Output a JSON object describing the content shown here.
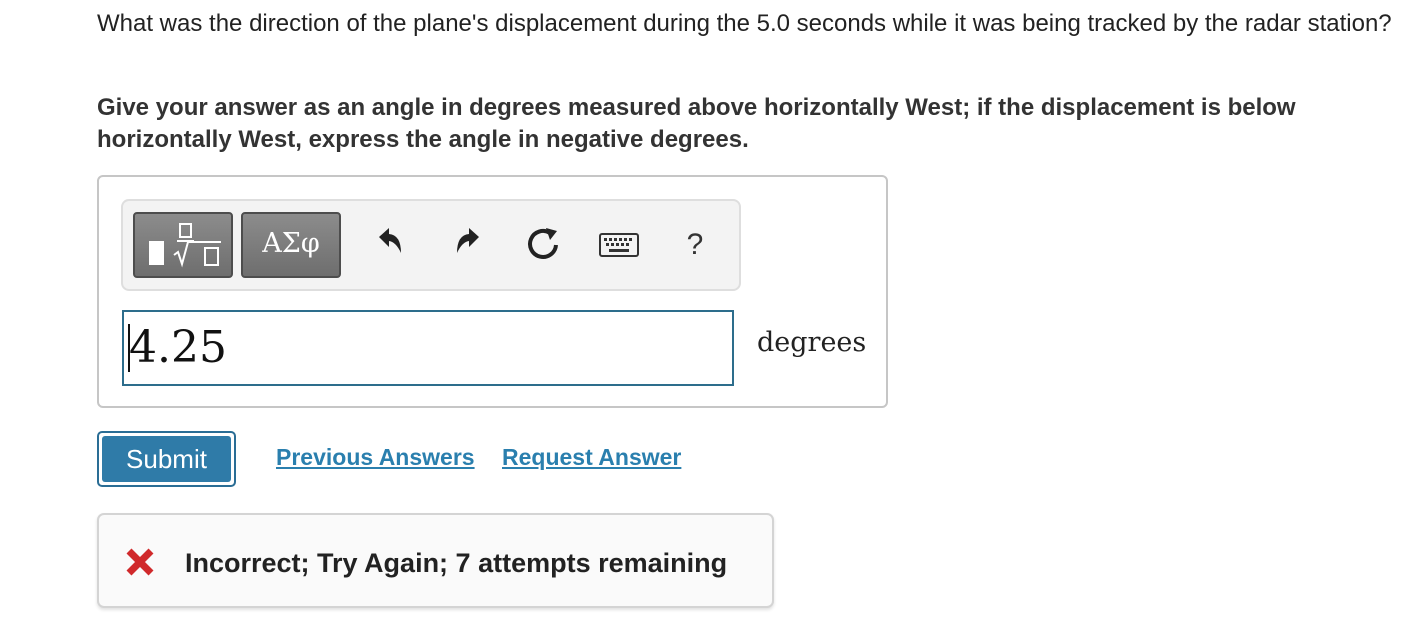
{
  "question": {
    "text": "What was the direction of the plane's displacement during the 5.0 seconds while it was being tracked by the radar station?",
    "instruction": "Give your answer as an angle in degrees measured above horizontally West; if the displacement is below horizontally West, express the angle in negative degrees."
  },
  "toolbar": {
    "templates_icon": "fraction-sqrt-templates-icon",
    "greek_label": "ΑΣφ",
    "undo_icon": "undo-arrow-icon",
    "redo_icon": "redo-arrow-icon",
    "reset_icon": "reset-circular-arrow-icon",
    "keyboard_icon": "keyboard-icon",
    "help_label": "?"
  },
  "answer": {
    "value": "4.25",
    "units": "degrees"
  },
  "actions": {
    "submit_label": "Submit",
    "previous_answers_label": "Previous Answers",
    "request_answer_label": "Request Answer"
  },
  "feedback": {
    "icon": "incorrect-x-icon",
    "message": "Incorrect; Try Again; 7 attempts remaining"
  },
  "colors": {
    "link": "#2a7fae",
    "submit": "#2f7ba8",
    "input_border": "#2d6d8c",
    "error_x": "#d0292b"
  }
}
